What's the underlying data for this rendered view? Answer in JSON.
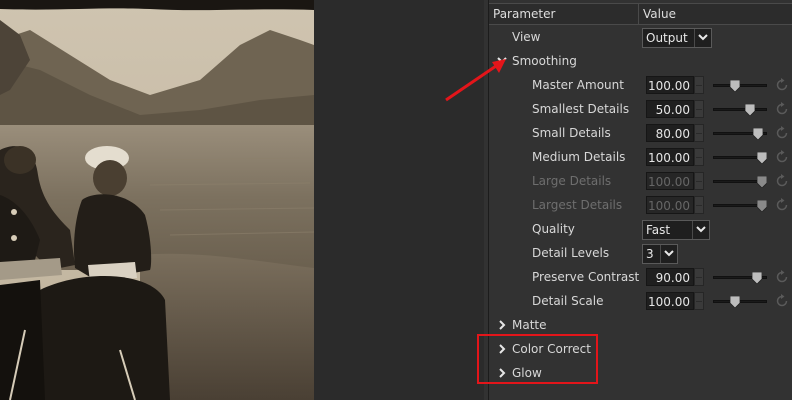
{
  "header": {
    "col_parameter": "Parameter",
    "col_value": "Value"
  },
  "view": {
    "label": "View",
    "value": "Output"
  },
  "groups": {
    "smoothing": "Smoothing",
    "matte": "Matte",
    "color_correct": "Color Correct",
    "glow": "Glow"
  },
  "params": [
    {
      "label": "Master Amount",
      "value": "100.00",
      "slider": 0.4,
      "enabled": true
    },
    {
      "label": "Smallest Details",
      "value": "50.00",
      "slider": 0.7,
      "enabled": true
    },
    {
      "label": "Small Details",
      "value": "80.00",
      "slider": 0.85,
      "enabled": true
    },
    {
      "label": "Medium Details",
      "value": "100.00",
      "slider": 0.93,
      "enabled": true
    },
    {
      "label": "Large Details",
      "value": "100.00",
      "slider": 0.93,
      "enabled": false
    },
    {
      "label": "Largest Details",
      "value": "100.00",
      "slider": 0.93,
      "enabled": false
    }
  ],
  "quality": {
    "label": "Quality",
    "value": "Fast"
  },
  "detail_levels": {
    "label": "Detail Levels",
    "value": "3"
  },
  "params2": [
    {
      "label": "Preserve Contrast",
      "value": "90.00",
      "slider": 0.82,
      "enabled": true
    },
    {
      "label": "Detail Scale",
      "value": "100.00",
      "slider": 0.4,
      "enabled": true
    }
  ],
  "colors": {
    "accent_annotation": "#e3151a",
    "panel": "#323232",
    "field": "#1f1f1f"
  }
}
